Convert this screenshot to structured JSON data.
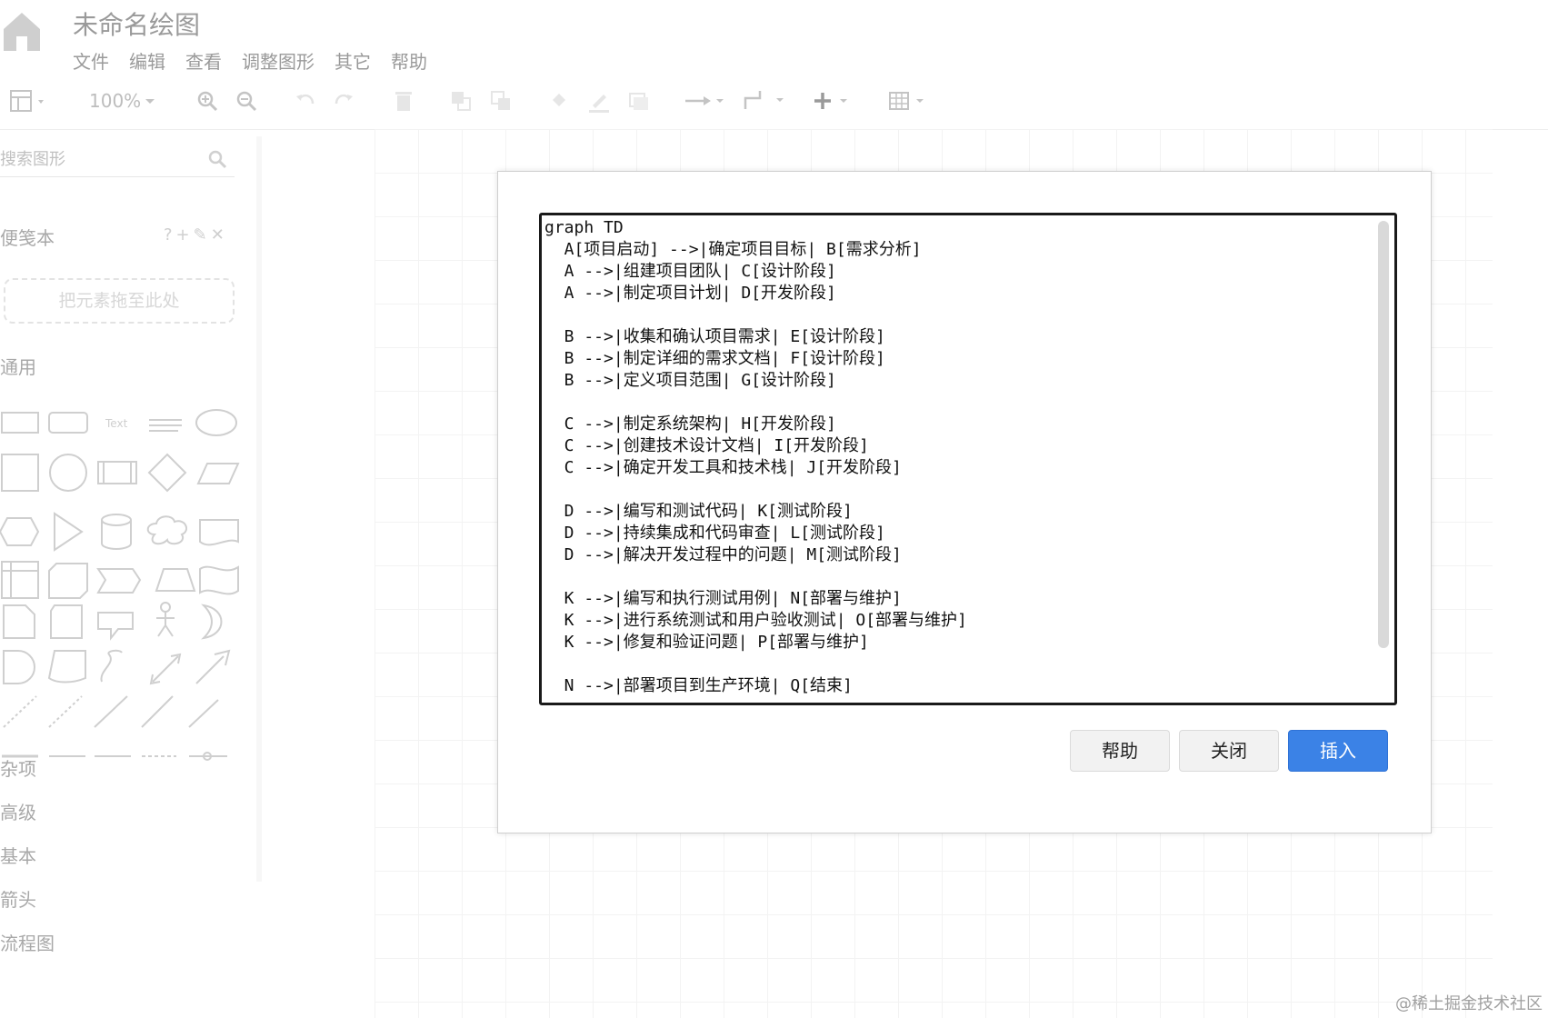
{
  "header": {
    "title": "未命名绘图",
    "menu": [
      "文件",
      "编辑",
      "查看",
      "调整图形",
      "其它",
      "帮助"
    ]
  },
  "toolbar": {
    "zoom": "100%"
  },
  "sidebar": {
    "search_placeholder": "搜索图形",
    "scratchpad_title": "便笺本",
    "scratchpad_tools": "?+✎✕",
    "dropzone_text": "把元素拖至此处",
    "sections": {
      "general": "通用",
      "misc": "杂项",
      "advanced": "高级",
      "basic": "基本",
      "arrows": "箭头",
      "flowchart": "流程图"
    },
    "text_shape_label": "Text"
  },
  "dialog": {
    "code": "graph TD\n  A[项目启动] -->|确定项目目标| B[需求分析]\n  A -->|组建项目团队| C[设计阶段]\n  A -->|制定项目计划| D[开发阶段]\n\n  B -->|收集和确认项目需求| E[设计阶段]\n  B -->|制定详细的需求文档| F[设计阶段]\n  B -->|定义项目范围| G[设计阶段]\n\n  C -->|制定系统架构| H[开发阶段]\n  C -->|创建技术设计文档| I[开发阶段]\n  C -->|确定开发工具和技术栈| J[开发阶段]\n\n  D -->|编写和测试代码| K[测试阶段]\n  D -->|持续集成和代码审查| L[测试阶段]\n  D -->|解决开发过程中的问题| M[测试阶段]\n\n  K -->|编写和执行测试用例| N[部署与维护]\n  K -->|进行系统测试和用户验收测试| O[部署与维护]\n  K -->|修复和验证问题| P[部署与维护]\n\n  N -->|部署项目到生产环境| Q[结束]",
    "buttons": {
      "help": "帮助",
      "close": "关闭",
      "insert": "插入"
    }
  },
  "watermark": "@稀土掘金技术社区",
  "colors": {
    "primary": "#3b82e6",
    "muted_text": "#a8a8a8"
  }
}
